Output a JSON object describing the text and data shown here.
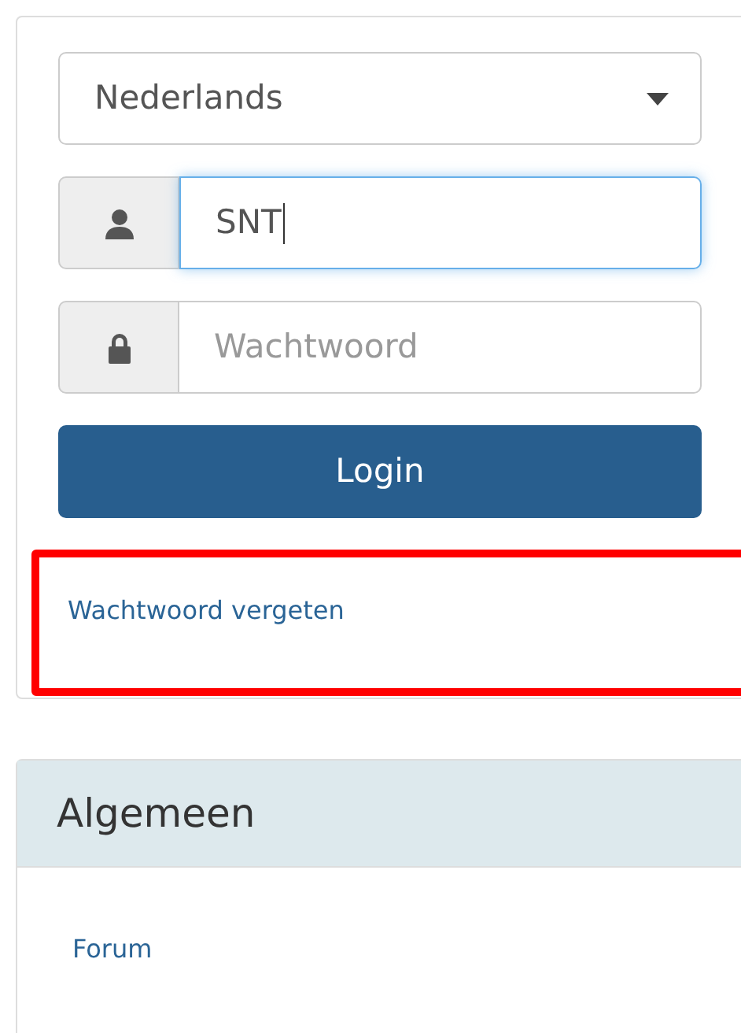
{
  "login_form": {
    "language": "Nederlands",
    "username": {
      "value": "SNT"
    },
    "password": {
      "placeholder": "Wachtwoord"
    },
    "login_button": "Login",
    "forgot_password_link": "Wachtwoord vergeten",
    "highlighted": true
  },
  "panel": {
    "title": "Algemeen",
    "links": [
      "Forum"
    ]
  }
}
